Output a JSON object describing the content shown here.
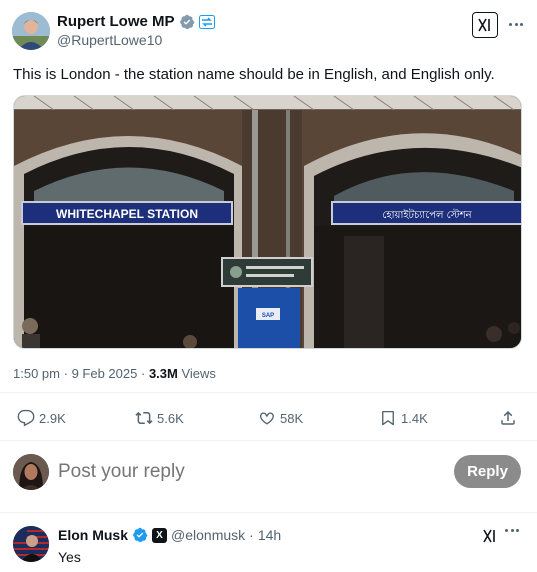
{
  "author": {
    "display_name": "Rupert Lowe MP",
    "handle": "@RupertLowe10"
  },
  "tweet": {
    "text": "This is London - the station name should be in English, and English only.",
    "media": {
      "sign_english": "WHITECHAPEL STATION",
      "sign_bengali": "হোয়াইটচ্যাপেল স্টেশন",
      "sap_label": "SAP"
    },
    "time": "1:50 pm",
    "date": "9 Feb 2025",
    "separator": "·",
    "views_count": "3.3M",
    "views_label": "Views"
  },
  "actions": {
    "replies": "2.9K",
    "reposts": "5.6K",
    "likes": "58K",
    "bookmarks": "1.4K"
  },
  "reply_composer": {
    "placeholder": "Post your reply",
    "button_label": "Reply"
  },
  "reply": {
    "display_name": "Elon Musk",
    "handle": "@elonmusk",
    "separator": "·",
    "time_ago": "14h",
    "text": "Yes"
  },
  "colors": {
    "text_primary": "#0f1419",
    "text_secondary": "#536471",
    "verified": "#1d9bf0",
    "reply_button": "#8b8b8b",
    "divider": "#eff3f4"
  }
}
